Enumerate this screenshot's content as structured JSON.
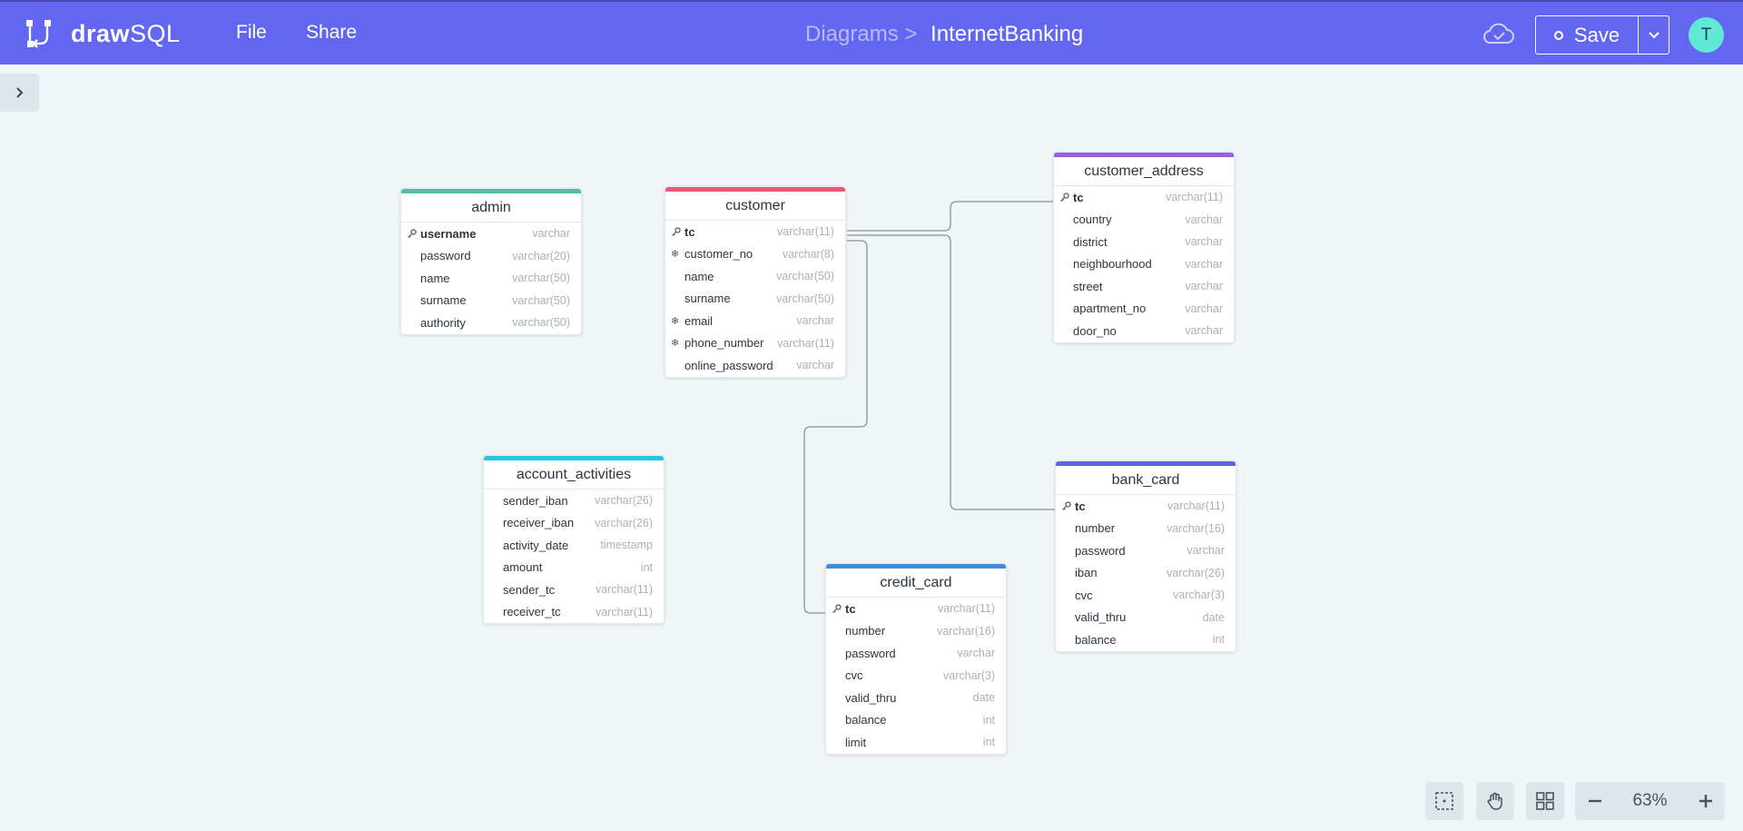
{
  "app": {
    "logo_bold": "draw",
    "logo_light": "SQL",
    "menu": {
      "file": "File",
      "share": "Share"
    },
    "breadcrumb": {
      "parent": "Diagrams >",
      "current": "InternetBanking"
    },
    "save_label": "Save",
    "avatar_initial": "T",
    "zoom": "63%",
    "accent": "#6366f1"
  },
  "tables": {
    "admin": {
      "name": "admin",
      "color": "#4cbfa6",
      "rows": [
        {
          "icon": "key",
          "name": "username",
          "type": "varchar",
          "pk": true
        },
        {
          "icon": "",
          "name": "password",
          "type": "varchar(20)"
        },
        {
          "icon": "",
          "name": "name",
          "type": "varchar(50)"
        },
        {
          "icon": "",
          "name": "surname",
          "type": "varchar(50)"
        },
        {
          "icon": "",
          "name": "authority",
          "type": "varchar(50)"
        }
      ]
    },
    "customer": {
      "name": "customer",
      "color": "#f0567a",
      "rows": [
        {
          "icon": "key",
          "name": "tc",
          "type": "varchar(11)",
          "pk": true
        },
        {
          "icon": "unique",
          "name": "customer_no",
          "type": "varchar(8)"
        },
        {
          "icon": "",
          "name": "name",
          "type": "varchar(50)"
        },
        {
          "icon": "",
          "name": "surname",
          "type": "varchar(50)"
        },
        {
          "icon": "unique",
          "name": "email",
          "type": "varchar"
        },
        {
          "icon": "unique",
          "name": "phone_number",
          "type": "varchar(11)"
        },
        {
          "icon": "",
          "name": "online_password",
          "type": "varchar"
        }
      ]
    },
    "customer_address": {
      "name": "customer_address",
      "color": "#9b5de5",
      "rows": [
        {
          "icon": "key",
          "name": "tc",
          "type": "varchar(11)",
          "pk": true
        },
        {
          "icon": "",
          "name": "country",
          "type": "varchar"
        },
        {
          "icon": "",
          "name": "district",
          "type": "varchar"
        },
        {
          "icon": "",
          "name": "neighbourhood",
          "type": "varchar"
        },
        {
          "icon": "",
          "name": "street",
          "type": "varchar"
        },
        {
          "icon": "",
          "name": "apartment_no",
          "type": "varchar"
        },
        {
          "icon": "",
          "name": "door_no",
          "type": "varchar"
        }
      ]
    },
    "account_activities": {
      "name": "account_activities",
      "color": "#22c7e0",
      "rows": [
        {
          "icon": "",
          "name": "sender_iban",
          "type": "varchar(26)"
        },
        {
          "icon": "",
          "name": "receiver_iban",
          "type": "varchar(26)"
        },
        {
          "icon": "",
          "name": "activity_date",
          "type": "timestamp"
        },
        {
          "icon": "",
          "name": "amount",
          "type": "int"
        },
        {
          "icon": "",
          "name": "sender_tc",
          "type": "varchar(11)"
        },
        {
          "icon": "",
          "name": "receiver_tc",
          "type": "varchar(11)"
        }
      ]
    },
    "bank_card": {
      "name": "bank_card",
      "color": "#5a67d8",
      "rows": [
        {
          "icon": "key",
          "name": "tc",
          "type": "varchar(11)",
          "pk": true
        },
        {
          "icon": "",
          "name": "number",
          "type": "varchar(16)"
        },
        {
          "icon": "",
          "name": "password",
          "type": "varchar"
        },
        {
          "icon": "",
          "name": "iban",
          "type": "varchar(26)"
        },
        {
          "icon": "",
          "name": "cvc",
          "type": "varchar(3)"
        },
        {
          "icon": "",
          "name": "valid_thru",
          "type": "date"
        },
        {
          "icon": "",
          "name": "balance",
          "type": "int"
        }
      ]
    },
    "credit_card": {
      "name": "credit_card",
      "color": "#3b8ede",
      "rows": [
        {
          "icon": "key",
          "name": "tc",
          "type": "varchar(11)",
          "pk": true
        },
        {
          "icon": "",
          "name": "number",
          "type": "varchar(16)"
        },
        {
          "icon": "",
          "name": "password",
          "type": "varchar"
        },
        {
          "icon": "",
          "name": "cvc",
          "type": "varchar(3)"
        },
        {
          "icon": "",
          "name": "valid_thru",
          "type": "date"
        },
        {
          "icon": "",
          "name": "balance",
          "type": "int"
        },
        {
          "icon": "",
          "name": "limit",
          "type": "int"
        }
      ]
    }
  }
}
